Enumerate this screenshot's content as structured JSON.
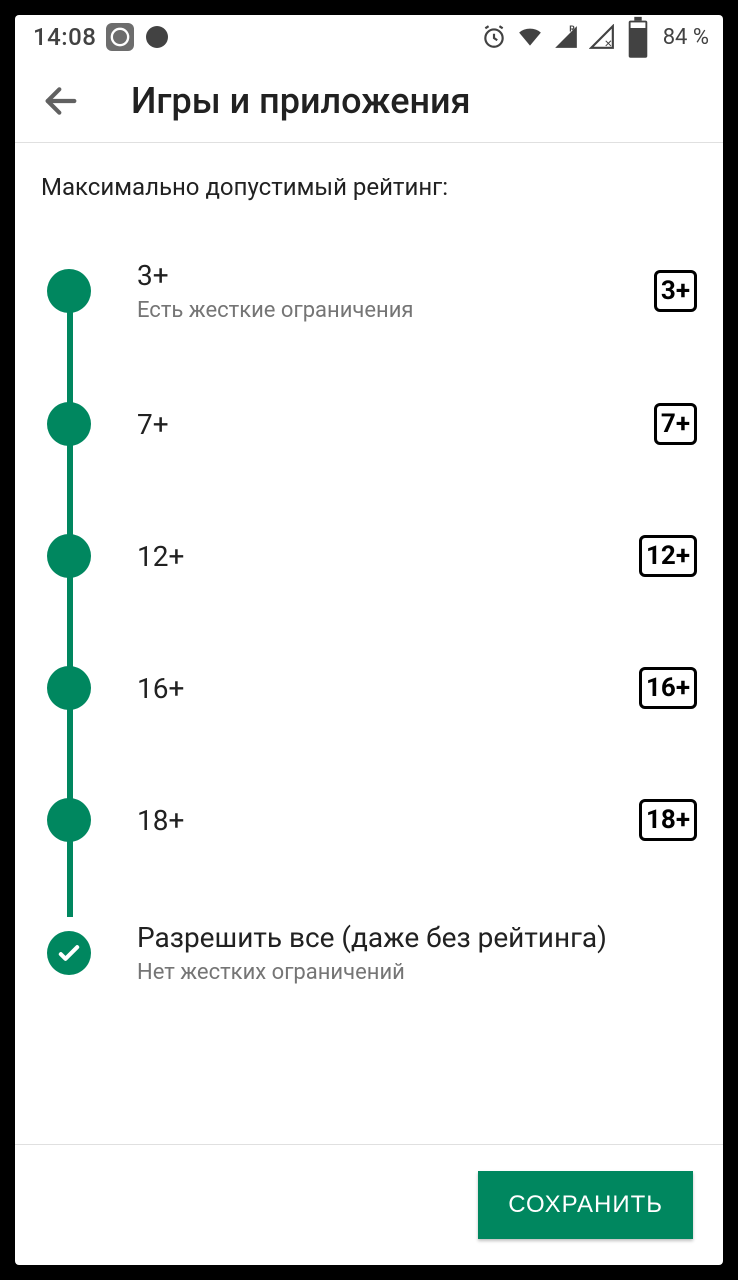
{
  "statusbar": {
    "time": "14:08",
    "battery": "84 %"
  },
  "header": {
    "title": "Игры и приложения"
  },
  "section_label": "Максимально допустимый рейтинг:",
  "options": [
    {
      "title": "3+",
      "subtitle": "Есть жесткие ограничения",
      "badge": "3+",
      "selected": false
    },
    {
      "title": "7+",
      "subtitle": "",
      "badge": "7+",
      "selected": false
    },
    {
      "title": "12+",
      "subtitle": "",
      "badge": "12+",
      "selected": false
    },
    {
      "title": "16+",
      "subtitle": "",
      "badge": "16+",
      "selected": false
    },
    {
      "title": "18+",
      "subtitle": "",
      "badge": "18+",
      "selected": false
    },
    {
      "title": "Разрешить все (даже без рейтинга)",
      "subtitle": "Нет жестких ограничений",
      "badge": "",
      "selected": true
    }
  ],
  "footer": {
    "save_label": "СОХРАНИТЬ"
  }
}
